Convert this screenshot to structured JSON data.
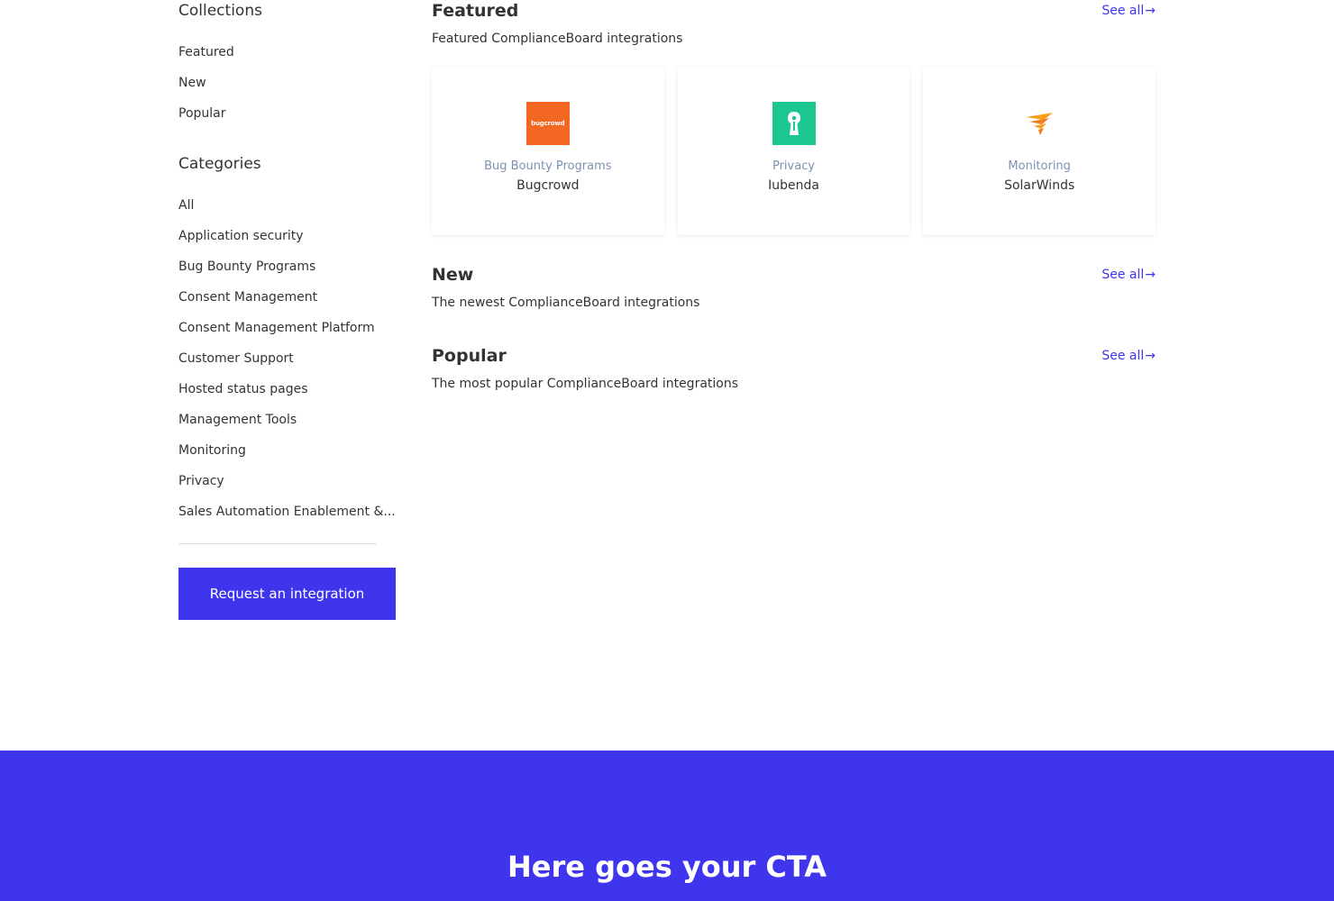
{
  "sidebar": {
    "collections_heading": "Collections",
    "collections": [
      {
        "label": "Featured"
      },
      {
        "label": "New"
      },
      {
        "label": "Popular"
      }
    ],
    "categories_heading": "Categories",
    "categories": [
      {
        "label": "All"
      },
      {
        "label": "Application security"
      },
      {
        "label": "Bug Bounty Programs"
      },
      {
        "label": "Consent Management"
      },
      {
        "label": "Consent Management Platform"
      },
      {
        "label": "Customer Support"
      },
      {
        "label": "Hosted status pages"
      },
      {
        "label": "Management Tools"
      },
      {
        "label": "Monitoring"
      },
      {
        "label": "Privacy"
      },
      {
        "label": "Sales Automation Enablement &..."
      }
    ],
    "request_button": "Request an integration"
  },
  "sections": {
    "featured": {
      "title": "Featured",
      "see_all": "See all",
      "arrow": "→",
      "description": "Featured ComplianceBoard integrations",
      "cards": [
        {
          "category": "Bug Bounty Programs",
          "name": "Bugcrowd",
          "logo_text": "bugcrowd",
          "logo_icon": "bugcrowd-logo-icon",
          "logo_color": "#f26822"
        },
        {
          "category": "Privacy",
          "name": "Iubenda",
          "logo_icon": "iubenda-logo-icon",
          "logo_color": "#1cc691"
        },
        {
          "category": "Monitoring",
          "name": "SolarWinds",
          "logo_icon": "solarwinds-logo-icon",
          "logo_color": "#f99d1c"
        }
      ]
    },
    "new": {
      "title": "New",
      "see_all": "See all",
      "arrow": "→",
      "description": "The newest ComplianceBoard integrations"
    },
    "popular": {
      "title": "Popular",
      "see_all": "See all",
      "arrow": "→",
      "description": "The most popular ComplianceBoard integrations"
    }
  },
  "cta": {
    "title": "Here goes your CTA"
  },
  "colors": {
    "accent": "#3f35ed",
    "card_category": "#7d91b3",
    "text": "#333333"
  }
}
